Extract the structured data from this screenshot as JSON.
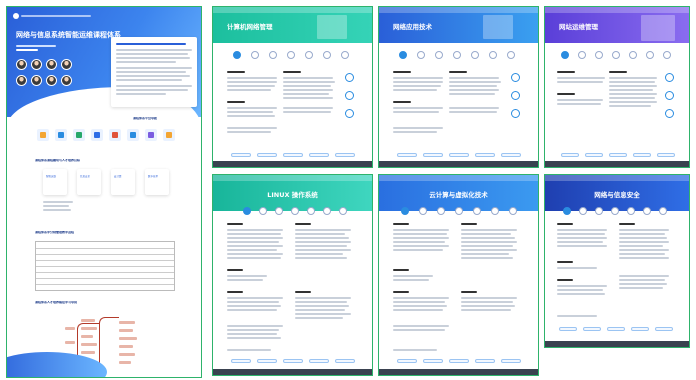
{
  "poster": {
    "title": "网络与信息系统智能运维课程体系",
    "sections": [
      "课程体系平台导航",
      "课程体系课程模块与人才培养目标",
      "课程体系学分制管理教学进程",
      "课程体系人才培养路径学习导向"
    ],
    "module_labels": [
      "智能运维",
      "信息安全",
      "云计算",
      "数字技术"
    ]
  },
  "cards": [
    {
      "title": "计算机网络管理",
      "theme": "teal"
    },
    {
      "title": "网络应用技术",
      "theme": "blue"
    },
    {
      "title": "网站运维管理",
      "theme": "purple"
    },
    {
      "title": "LINUX 操作系统",
      "theme": "teal"
    },
    {
      "title": "云计算与虚拟化技术",
      "theme": "blue"
    },
    {
      "title": "网络与信息安全",
      "theme": "darkblue"
    }
  ],
  "colors": {
    "border": "#2eb36b",
    "teal": "#22c3a8",
    "blue": "#2f6ee6",
    "purple": "#6a4de0",
    "darkblue": "#2545b8"
  }
}
